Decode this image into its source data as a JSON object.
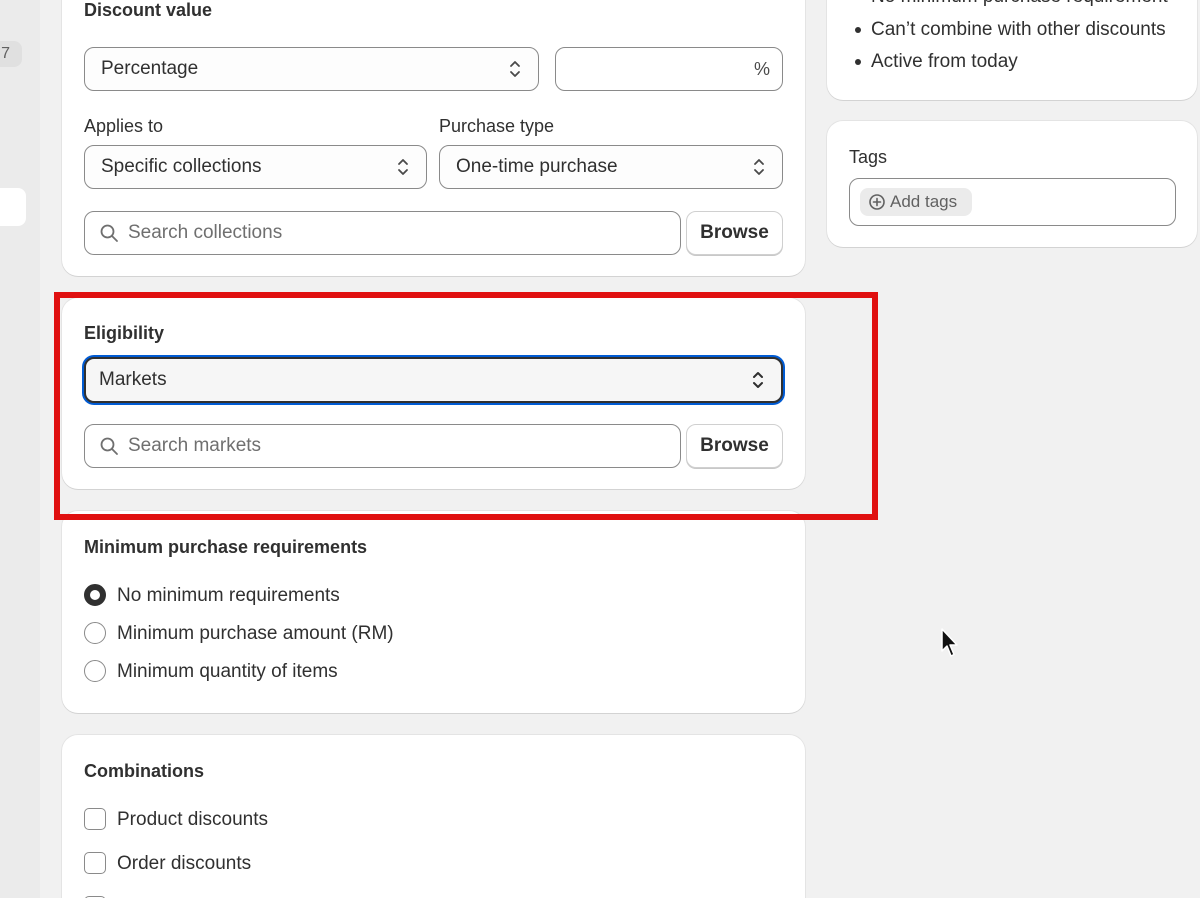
{
  "nav": {
    "badge": "7"
  },
  "discount_value": {
    "title": "Discount value",
    "type_select": "Percentage",
    "amount_value": "",
    "amount_suffix": "%",
    "applies_to_label": "Applies to",
    "applies_to_select": "Specific collections",
    "purchase_type_label": "Purchase type",
    "purchase_type_select": "One-time purchase",
    "search_placeholder": "Search collections",
    "browse_label": "Browse"
  },
  "eligibility": {
    "title": "Eligibility",
    "select": "Markets",
    "search_placeholder": "Search markets",
    "browse_label": "Browse"
  },
  "minimum_requirements": {
    "title": "Minimum purchase requirements",
    "options": [
      {
        "label": "No minimum requirements",
        "selected": true
      },
      {
        "label": "Minimum purchase amount (RM)",
        "selected": false
      },
      {
        "label": "Minimum quantity of items",
        "selected": false
      }
    ]
  },
  "combinations": {
    "title": "Combinations",
    "options": [
      {
        "label": "Product discounts",
        "checked": false
      },
      {
        "label": "Order discounts",
        "checked": false
      }
    ]
  },
  "summary": {
    "items": [
      "No minimum purchase requirement",
      "Can’t combine with other discounts",
      "Active from today"
    ]
  },
  "tags": {
    "title": "Tags",
    "add_label": "Add tags"
  },
  "colors": {
    "background": "#f1f1f1",
    "card": "#ffffff",
    "focus_ring": "#005bd3",
    "highlight": "#e01010",
    "text": "#303030"
  }
}
